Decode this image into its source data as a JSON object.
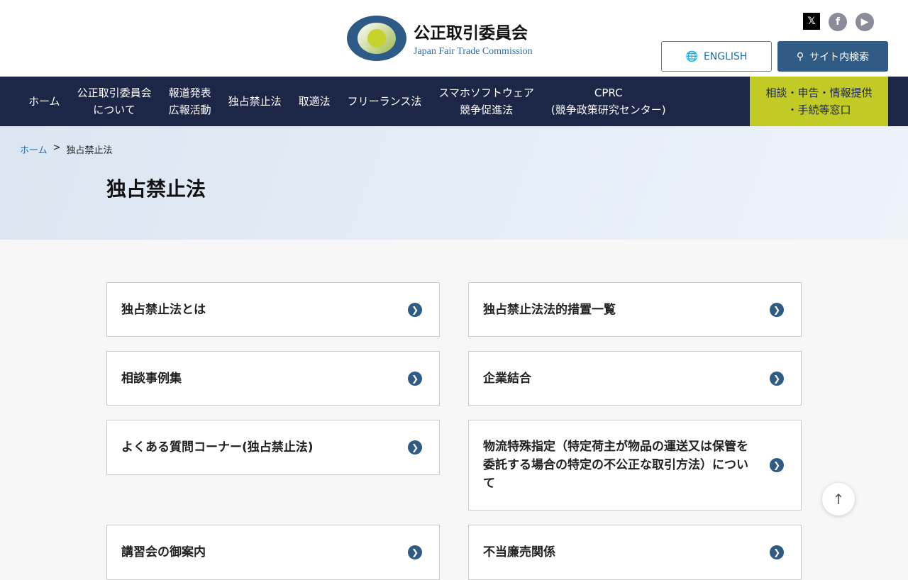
{
  "header": {
    "logo_ja": "公正取引委員会",
    "logo_en": "Japan Fair Trade Commission",
    "english": "ENGLISH",
    "search": "サイト内検索",
    "social": [
      "x-icon",
      "facebook-icon",
      "youtube-icon"
    ]
  },
  "nav": {
    "items": [
      "ホーム",
      "公正取引委員会\nについて",
      "報道発表\n広報活動",
      "独占禁止法",
      "取適法",
      "フリーランス法",
      "スマホソフトウェア\n競争促進法",
      "CPRC\n(競争政策研究センター)"
    ],
    "consult": "相談・申告・情報提供\n・手続等窓口"
  },
  "breadcrumb": {
    "home": "ホーム",
    "sep": ">",
    "current": "独占禁止法"
  },
  "page_title": "独占禁止法",
  "cards": [
    "独占禁止法とは",
    "独占禁止法法的措置一覧",
    "相談事例集",
    "企業結合",
    "よくある質問コーナー(独占禁止法)",
    "物流特殊指定（特定荷主が物品の運送又は保管を委託する場合の特定の不公正な取引方法）について",
    "講習会の御案内",
    "不当廉売関係"
  ]
}
